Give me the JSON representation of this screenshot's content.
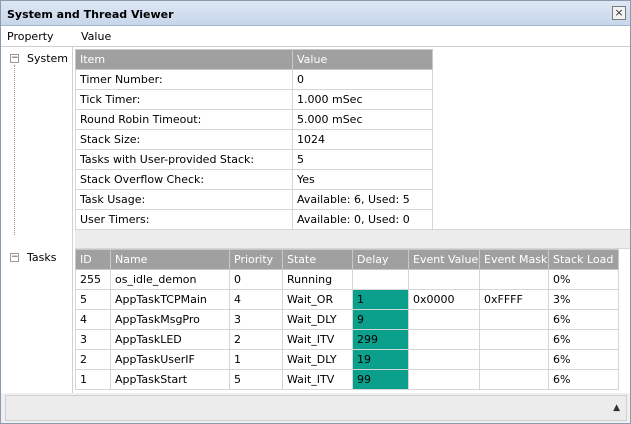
{
  "window": {
    "title": "System and Thread Viewer",
    "close_glyph": "×"
  },
  "header": {
    "col_property": "Property",
    "col_value": "Value"
  },
  "tree": [
    {
      "label": "System",
      "expander": "−"
    },
    {
      "label": "Tasks",
      "expander": "−"
    }
  ],
  "system_table": {
    "columns": [
      "Item",
      "Value"
    ],
    "rows": [
      [
        "Timer Number:",
        "0"
      ],
      [
        "Tick Timer:",
        "1.000 mSec"
      ],
      [
        "Round Robin Timeout:",
        "5.000 mSec"
      ],
      [
        "Stack Size:",
        "1024"
      ],
      [
        "Tasks with User-provided Stack:",
        "5"
      ],
      [
        "Stack Overflow Check:",
        "Yes"
      ],
      [
        "Task Usage:",
        "Available: 6, Used: 5"
      ],
      [
        "User Timers:",
        "Available: 0, Used: 0"
      ]
    ]
  },
  "tasks_table": {
    "columns": [
      "ID",
      "Name",
      "Priority",
      "State",
      "Delay",
      "Event Value",
      "Event Mask",
      "Stack Load"
    ],
    "rows": [
      [
        "255",
        "os_idle_demon",
        "0",
        "Running",
        "",
        "",
        "",
        "0%"
      ],
      [
        "5",
        "AppTaskTCPMain",
        "4",
        "Wait_OR",
        "1",
        "0x0000",
        "0xFFFF",
        "3%"
      ],
      [
        "4",
        "AppTaskMsgPro",
        "3",
        "Wait_DLY",
        "9",
        "",
        "",
        "6%"
      ],
      [
        "3",
        "AppTaskLED",
        "2",
        "Wait_ITV",
        "299",
        "",
        "",
        "6%"
      ],
      [
        "2",
        "AppTaskUserIF",
        "1",
        "Wait_DLY",
        "19",
        "",
        "",
        "6%"
      ],
      [
        "1",
        "AppTaskStart",
        "5",
        "Wait_ITV",
        "99",
        "",
        "",
        "6%"
      ]
    ],
    "delay_highlight_color": "#0aa08c"
  },
  "statusbar": {
    "scroll_glyph": "▲"
  }
}
